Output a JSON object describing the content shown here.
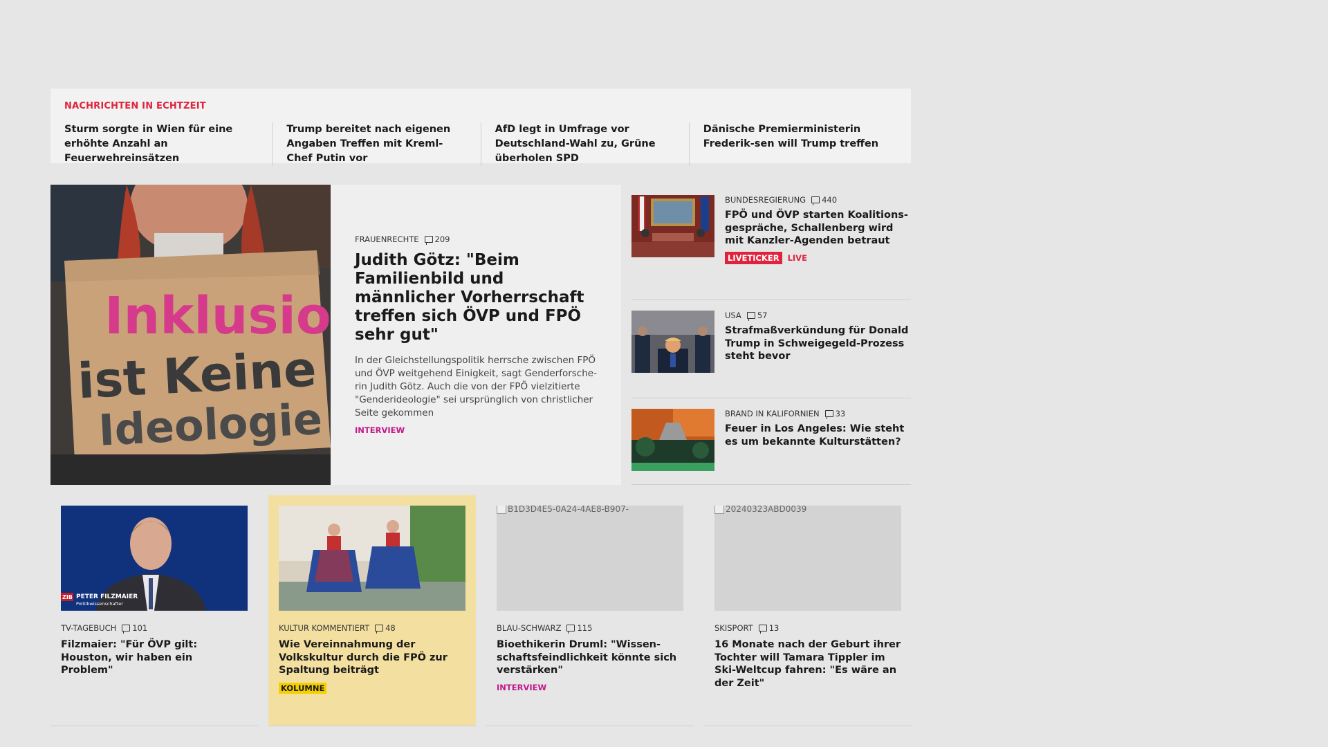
{
  "ticker": {
    "label": "NACHRICHTEN IN ECHTZEIT",
    "items": [
      "Sturm sorgte in Wien für eine erhöhte Anzahl an Feuerwehreinsätzen",
      "Trump bereitet nach eigenen Angaben Treffen mit Kreml-Chef Putin vor",
      "AfD legt in Umfrage vor Deutschland-Wahl zu, Grüne überholen SPD",
      "Dänische Premierministerin Frederik-sen will Trump treffen"
    ]
  },
  "lead": {
    "sign_line1": "Inklusion",
    "sign_line2": "ist Keine",
    "sign_line3": "Ideologie",
    "kicker": "FRAUENRECHTE",
    "comments": "209",
    "title": "Judith Götz: \"Beim Familienbild und männlicher Vorherrschaft treffen sich ÖVP und FPÖ sehr gut\"",
    "teaser": "In der Gleichstellungspolitik herrsche zwischen FPÖ und ÖVP weitgehend Einigkeit, sagt Genderforsche-rin Judith Götz. Auch die von der FPÖ vielzitierte \"Genderideologie\" sei ursprünglich von christlicher Seite gekommen",
    "tag": "INTERVIEW"
  },
  "side": [
    {
      "kicker": "BUNDESREGIERUNG",
      "comments": "440",
      "title": "FPÖ und ÖVP starten Koalitions-gespräche, Schallenberg wird mit Kanzler-Agenden betraut",
      "badge": "LIVETICKER",
      "live": "LIVE"
    },
    {
      "kicker": "USA",
      "comments": "57",
      "title": "Strafmaßverkündung für Donald Trump in Schweigegeld-Prozess steht bevor"
    },
    {
      "kicker": "BRAND IN KALIFORNIEN",
      "comments": "33",
      "title": "Feuer in Los Angeles: Wie steht es um bekannte Kulturstätten?"
    }
  ],
  "cards": [
    {
      "kicker": "TV-TAGEBUCH",
      "comments": "101",
      "title": "Filzmaier: \"Für ÖVP gilt: Houston, wir haben ein Problem\"",
      "caption_name": "PETER FILZMAIER",
      "caption_role": "Politikwissenschafter",
      "caption_logo": "ZIB"
    },
    {
      "kicker": "KULTUR KOMMENTIERT",
      "comments": "48",
      "title": "Wie Vereinnahmung der Volkskultur durch die FPÖ zur Spaltung beiträgt",
      "tag": "KOLUMNE"
    },
    {
      "kicker": "BLAU-SCHWARZ",
      "comments": "115",
      "title": "Bioethikerin Druml: \"Wissen-schaftsfeindlichkeit könnte sich verstärken\"",
      "tag": "INTERVIEW",
      "img_alt": "B1D3D4E5-0A24-4AE8-B907-"
    },
    {
      "kicker": "SKISPORT",
      "comments": "13",
      "title": "16 Monate nach der Geburt ihrer Tochter will Tamara Tippler im Ski-Weltcup fahren: \"Es wäre an der Zeit\"",
      "img_alt": "20240323ABD0039"
    }
  ],
  "colors": {
    "accent_red": "#e0233d",
    "interview_magenta": "#c2188a",
    "kolumne_yellow": "#f5d000",
    "highlight_bg": "#f3e0a0"
  }
}
